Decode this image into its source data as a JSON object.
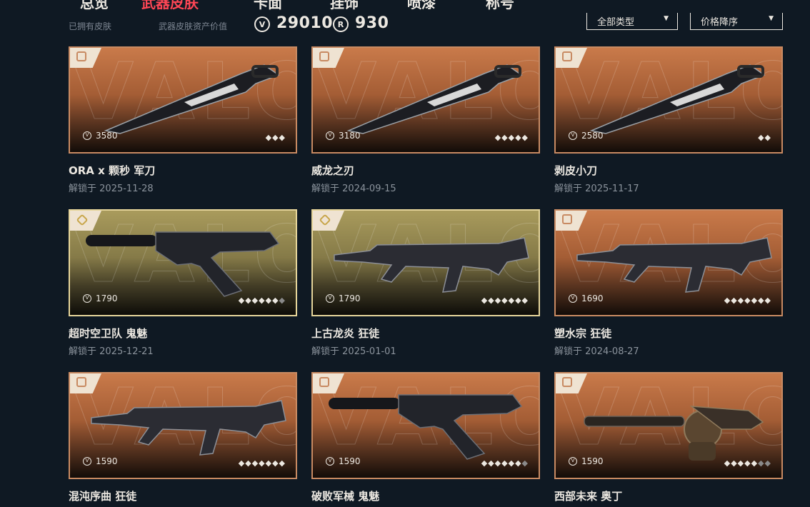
{
  "nav": {
    "tabs": [
      {
        "label": "总览",
        "active": false
      },
      {
        "label": "武器皮肤",
        "active": true
      },
      {
        "label": "卡面",
        "active": false
      },
      {
        "label": "挂饰",
        "active": false
      },
      {
        "label": "喷漆",
        "active": false
      },
      {
        "label": "称号",
        "active": false
      }
    ]
  },
  "stats": {
    "owned_label": "已拥有皮肤",
    "asset_label": "武器皮肤资产价值",
    "vp_icon": "valorant-points-icon",
    "vp_value": "29010",
    "rp_icon": "radianite-points-icon",
    "rp_value": "930"
  },
  "filters": {
    "type_label": "全部类型",
    "sort_label": "价格降序"
  },
  "colors": {
    "background": "#0f1923",
    "accent": "#ff4655",
    "tier_orange": "#c97a4a",
    "tier_gold": "#a99b5c"
  },
  "unlock_prefix": "解锁于",
  "cards": [
    {
      "name": "ORA x 颗秒 军刀",
      "date": "2025-11-28",
      "price": "3580",
      "tier": "orange",
      "rarity_on": 3,
      "rarity_total": 3,
      "weapon": "knife-icon"
    },
    {
      "name": "威龙之刃",
      "date": "2024-09-15",
      "price": "3180",
      "tier": "orange",
      "rarity_on": 5,
      "rarity_total": 5,
      "weapon": "knife-icon"
    },
    {
      "name": "剥皮小刀",
      "date": "2025-11-17",
      "price": "2580",
      "tier": "orange",
      "rarity_on": 2,
      "rarity_total": 2,
      "weapon": "knife-icon"
    },
    {
      "name": "超时空卫队 鬼魅",
      "date": "2025-12-21",
      "price": "1790",
      "tier": "gold",
      "rarity_on": 6,
      "rarity_total": 7,
      "weapon": "pistol-icon"
    },
    {
      "name": "上古龙炎 狂徒",
      "date": "2025-01-01",
      "price": "1790",
      "tier": "gold",
      "rarity_on": 7,
      "rarity_total": 7,
      "weapon": "rifle-icon"
    },
    {
      "name": "塑水宗 狂徒",
      "date": "2024-08-27",
      "price": "1690",
      "tier": "orange",
      "rarity_on": 7,
      "rarity_total": 7,
      "weapon": "rifle-icon"
    },
    {
      "name": "混沌序曲 狂徒",
      "date": "",
      "price": "1590",
      "tier": "orange",
      "rarity_on": 7,
      "rarity_total": 7,
      "weapon": "rifle-icon"
    },
    {
      "name": "破败军械 鬼魅",
      "date": "",
      "price": "1590",
      "tier": "orange",
      "rarity_on": 6,
      "rarity_total": 7,
      "weapon": "pistol-icon"
    },
    {
      "name": "西部未来 奥丁",
      "date": "",
      "price": "1590",
      "tier": "orange",
      "rarity_on": 5,
      "rarity_total": 7,
      "weapon": "minigun-icon"
    }
  ]
}
